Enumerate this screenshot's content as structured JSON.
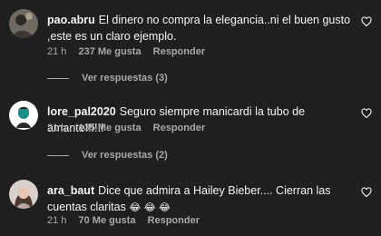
{
  "comments": [
    {
      "username": "pao.abru",
      "text": "El dinero no compra la elegancia..ni el buen gusto ,este es un claro ejemplo.",
      "time": "21 h",
      "likes": "237 Me gusta",
      "reply_label": "Responder",
      "view_replies": "Ver respuestas (3)"
    },
    {
      "username": "lore_pal2020",
      "text": "Seguro siempre manicardi la tubo de amante!!!!!!",
      "time": "21 h",
      "likes": "135 Me gusta",
      "reply_label": "Responder",
      "view_replies": "Ver respuestas (2)"
    },
    {
      "username": "ara_baut",
      "text": "Dice que admira a Hailey Bieber.... Cierran las cuentas claritas",
      "emojis": "😂 😂 😂",
      "time": "21 h",
      "likes": "70 Me gusta",
      "reply_label": "Responder"
    }
  ],
  "icons": {
    "like": "heart-outline-icon"
  },
  "colors": {
    "background": "#1f1f1f",
    "text": "#f5f5f5",
    "muted": "#a8a8a8"
  }
}
